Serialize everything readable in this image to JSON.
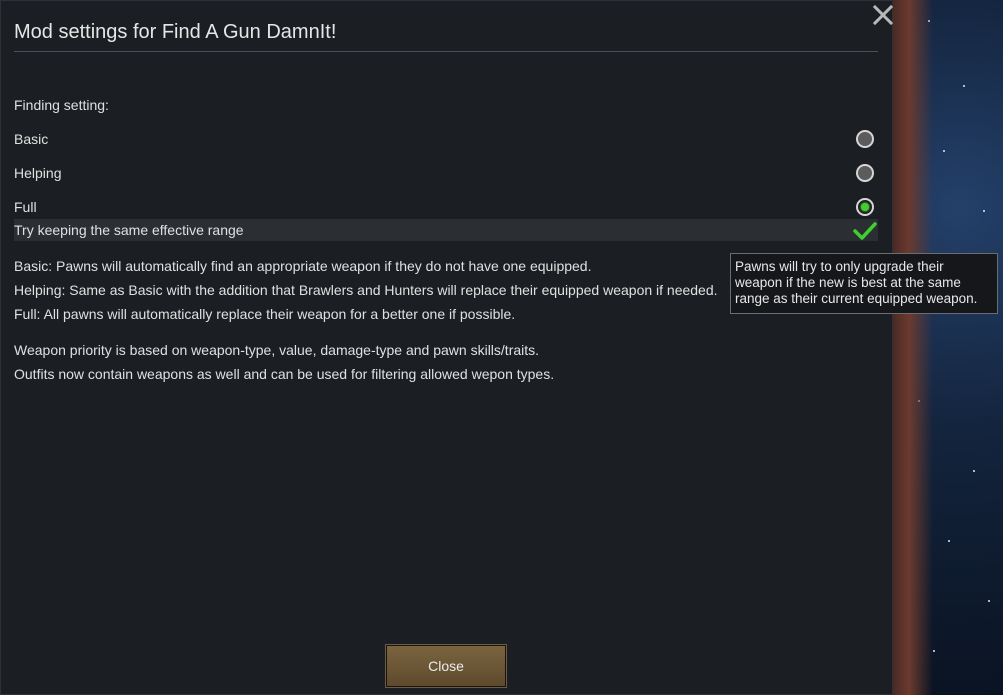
{
  "dialog": {
    "title": "Mod settings for Find A Gun DamnIt!",
    "close_button_label": "Close"
  },
  "settings": {
    "section_label": "Finding setting:",
    "options": [
      {
        "label": "Basic",
        "selected": false
      },
      {
        "label": "Helping",
        "selected": false
      },
      {
        "label": "Full",
        "selected": true
      }
    ],
    "checkbox": {
      "label": "Try keeping the same effective range",
      "checked": true
    }
  },
  "descriptions": [
    "Basic: Pawns will automatically find an appropriate weapon if they do not have one equipped.",
    "Helping: Same as Basic with the addition that Brawlers and Hunters will replace their equipped weapon if needed.",
    "Full: All pawns will automatically replace their weapon for a better one if possible."
  ],
  "notes": [
    "Weapon priority is based on weapon-type, value, damage-type and pawn skills/traits.",
    "Outfits now contain weapons as well and can be used for filtering allowed wepon types."
  ],
  "tooltip": {
    "lines": [
      "Pawns will try to only upgrade their",
      "weapon if the new is best at the same",
      "range as their current equipped weapon."
    ]
  },
  "colors": {
    "accent_green": "#3fcf2f",
    "button_brown": "#6b5534",
    "dialog_bg": "#1b1e23"
  },
  "icons": {
    "close": "x-icon",
    "check": "checkmark-icon"
  }
}
